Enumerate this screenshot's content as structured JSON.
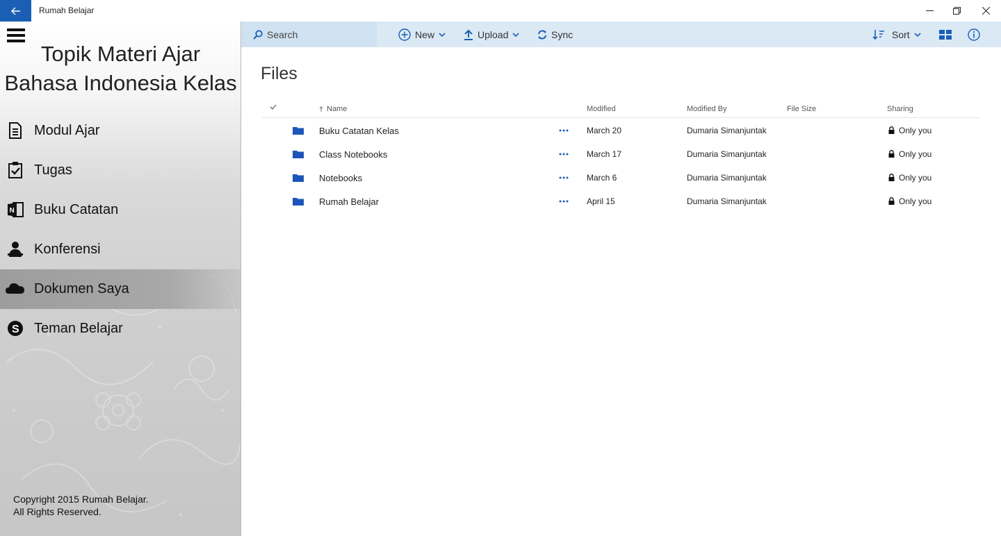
{
  "app": {
    "title": "Rumah Belajar"
  },
  "sidebar": {
    "title_line1": "Topik Materi Ajar",
    "title_line2": "Bahasa Indonesia Kelas",
    "items": [
      {
        "label": "Modul Ajar",
        "icon": "document-icon"
      },
      {
        "label": "Tugas",
        "icon": "clipboard-check-icon"
      },
      {
        "label": "Buku Catatan",
        "icon": "onenote-icon"
      },
      {
        "label": "Konferensi",
        "icon": "presenter-icon"
      },
      {
        "label": "Dokumen Saya",
        "icon": "cloud-icon",
        "active": true
      },
      {
        "label": "Teman Belajar",
        "icon": "skype-icon"
      }
    ],
    "copyright_line1": "Copyright 2015 Rumah Belajar.",
    "copyright_line2": "All Rights Reserved."
  },
  "toolbar": {
    "search_label": "Search",
    "new_label": "New",
    "upload_label": "Upload",
    "sync_label": "Sync",
    "sort_label": "Sort"
  },
  "main": {
    "heading": "Files",
    "columns": {
      "name": "Name",
      "modified": "Modified",
      "modified_by": "Modified By",
      "file_size": "File Size",
      "sharing": "Sharing"
    },
    "rows": [
      {
        "name": "Buku Catatan Kelas",
        "modified": "March 20",
        "modified_by": "Dumaria Simanjuntak",
        "file_size": "",
        "sharing": "Only you"
      },
      {
        "name": "Class Notebooks",
        "modified": "March 17",
        "modified_by": "Dumaria Simanjuntak",
        "file_size": "",
        "sharing": "Only you"
      },
      {
        "name": "Notebooks",
        "modified": "March 6",
        "modified_by": "Dumaria Simanjuntak",
        "file_size": "",
        "sharing": "Only you"
      },
      {
        "name": "Rumah Belajar",
        "modified": "April 15",
        "modified_by": "Dumaria Simanjuntak",
        "file_size": "",
        "sharing": "Only you"
      }
    ]
  },
  "colors": {
    "accent": "#1a5fb4",
    "command_bar": "#dbe9f5",
    "folder": "#1d56b8"
  }
}
